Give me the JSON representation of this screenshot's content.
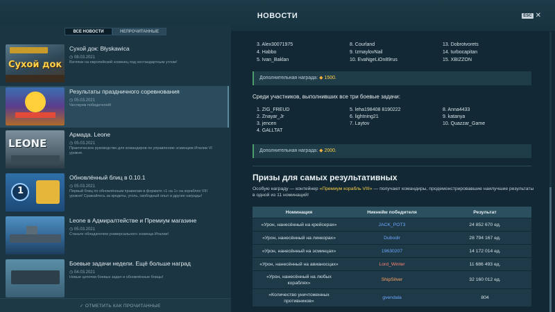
{
  "header": {
    "title": "НОВОСТИ",
    "esc_label": "ESC"
  },
  "tabs": [
    {
      "label": "ВСЕ НОВОСТИ"
    },
    {
      "label": "НЕПРОЧИТАННЫЕ"
    }
  ],
  "news": [
    {
      "title": "Сухой док: Błyskawica",
      "date": "08.03.2021",
      "desc": "Взгляни на европейский эсминец под нестандартным углом!",
      "thumb_text": "Сухой док"
    },
    {
      "title": "Результаты праздничного соревнования",
      "date": "05.03.2021",
      "desc": "Чествуем победителей!",
      "thumb_text": ""
    },
    {
      "title": "Армада. Leone",
      "date": "05.03.2021",
      "desc": "Практическое руководство для командиров по управлению эсминцем Италии VI уровня.",
      "thumb_text": "LEONE"
    },
    {
      "title": "Обновлённый блиц в 0.10.1",
      "date": "05.03.2021",
      "desc": "Первый блиц по обновлённым правилам в формате «1 на 1» на кораблях VIII уровня! Сражайтесь за кредиты, уголь, свободный опыт и другие награды!",
      "thumb_text": "1"
    },
    {
      "title": "Leone в Адмиралтействе и Премиум магазине",
      "date": "05.03.2021",
      "desc": "Станьте обладателем универсального эсминца Италии!",
      "thumb_text": ""
    },
    {
      "title": "Боевые задачи недели. Ещё больше наград",
      "date": "04.03.2021",
      "desc": "Новые цепочки боевых задач и обновлённые блицы!",
      "thumb_text": ""
    }
  ],
  "footer": {
    "mark_read": "ОТМЕТИТЬ КАК ПРОЧИТАННЫЕ"
  },
  "article": {
    "top_winners": {
      "col1": [
        "3. Alex30071975",
        "4. Habbo",
        "5. Ivan_Baklan"
      ],
      "col2": [
        "8. Courland",
        "9. IzmaylovNail",
        "10. EvaNgeLiOn89rus"
      ],
      "col3": [
        "13. Dobrotvorets",
        "14. turbocapitan",
        "15. XBIZZON"
      ]
    },
    "reward1": {
      "label": "Дополнительная награда:",
      "amount": "1500."
    },
    "subheading": "Среди участников, выполнивших все три боевые задачи:",
    "all_tasks": {
      "col1": [
        "1. ZIG_FREUD",
        "2. Znayar_Jr",
        "3. jencen",
        "4. GALLTAT"
      ],
      "col2": [
        "5. leha198408 8190222",
        "6. lightning21",
        "7. Laytov"
      ],
      "col3": [
        "8. Anna4433",
        "9. katanya",
        "10. Quazzar_Game"
      ]
    },
    "reward2": {
      "label": "Дополнительная награда:",
      "amount": "2000."
    },
    "section_title": "Призы для самых результативных",
    "desc_before": "Особую награду — контейнер ",
    "desc_hl": "«Премиум корабль VIII»",
    "desc_after": " — получают командиры, продемонстрировавшие наилучшие результаты в одной из 11 номинаций!",
    "table": {
      "headers": [
        "Номинация",
        "Никнейм победителя",
        "Результат"
      ],
      "rows": [
        {
          "nomination": "«Урон, нанесённый на крейсерах»",
          "winner": "JACK_POT3",
          "result": "24 852 670 ед.",
          "color": "blue"
        },
        {
          "nomination": "«Урон, нанесённый на линкорах»",
          "winner": "Dubodir",
          "result": "28 794 167 ед.",
          "color": "blue"
        },
        {
          "nomination": "«Урон, нанесённый на эсминцах»",
          "winner": "19630207",
          "result": "14 172 014 ед.",
          "color": "blue"
        },
        {
          "nomination": "«Урон, нанесённый на авианосцах»",
          "winner": "Lord_Winter",
          "result": "11 686 493 ед.",
          "color": "red"
        },
        {
          "nomination": "«Урон, нанесённый на любых кораблях»",
          "winner": "ShipSilver",
          "result": "32 160 012 ед.",
          "color": "orange"
        },
        {
          "nomination": "«Количество уничтоженных противников»",
          "winner": "gvendala",
          "result": "804",
          "color": "blue"
        }
      ]
    }
  }
}
